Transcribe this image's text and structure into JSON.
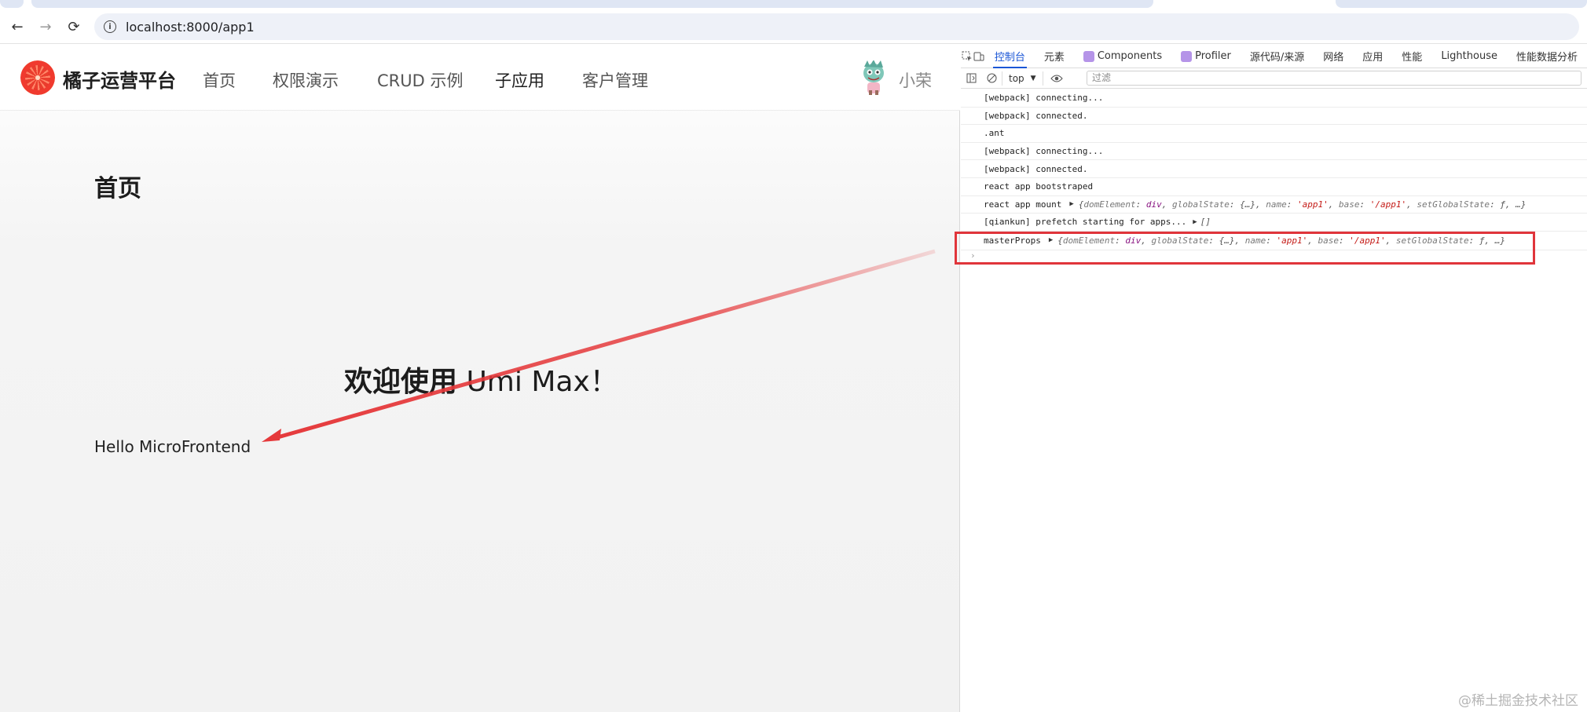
{
  "browser": {
    "url": "localhost:8000/app1",
    "nav": {
      "back": "←",
      "forward": "→",
      "reload": "⟳"
    }
  },
  "app": {
    "brand": "橘子运营平台",
    "menu": [
      "首页",
      "权限演示",
      "CRUD 示例",
      "子应用",
      "客户管理"
    ],
    "active_menu": "子应用",
    "user": "小荣",
    "page_title": "首页",
    "welcome_bold": "欢迎使用",
    "welcome_rest": " Umi Max！",
    "hello": "Hello MicroFrontend"
  },
  "devtools": {
    "tabs": [
      "控制台",
      "元素",
      "Components",
      "Profiler",
      "源代码/来源",
      "网络",
      "应用",
      "性能",
      "Lighthouse",
      "性能数据分析"
    ],
    "active_tab": "控制台",
    "context": "top",
    "filter_placeholder": "过滤",
    "logs": [
      "[webpack] connecting...",
      "[webpack] connected.",
      ".ant",
      "[webpack] connecting...",
      "[webpack] connected.",
      "react app bootstraped"
    ],
    "mount_prefix": "react app mount",
    "mount_obj": {
      "domElement": "div",
      "globalState": "{…}",
      "name": "'app1'",
      "base": "'/app1'",
      "setGlobalState": "ƒ, …"
    },
    "prefetch": "[qiankun] prefetch starting for apps...",
    "prefetch_obj": "[]",
    "master_prefix": "masterProps",
    "prompt": "›"
  },
  "colors": {
    "accent": "#1a56d6",
    "highlight": "#e0353b",
    "arrow": "#e5393b"
  },
  "watermark": "@稀土掘金技术社区"
}
